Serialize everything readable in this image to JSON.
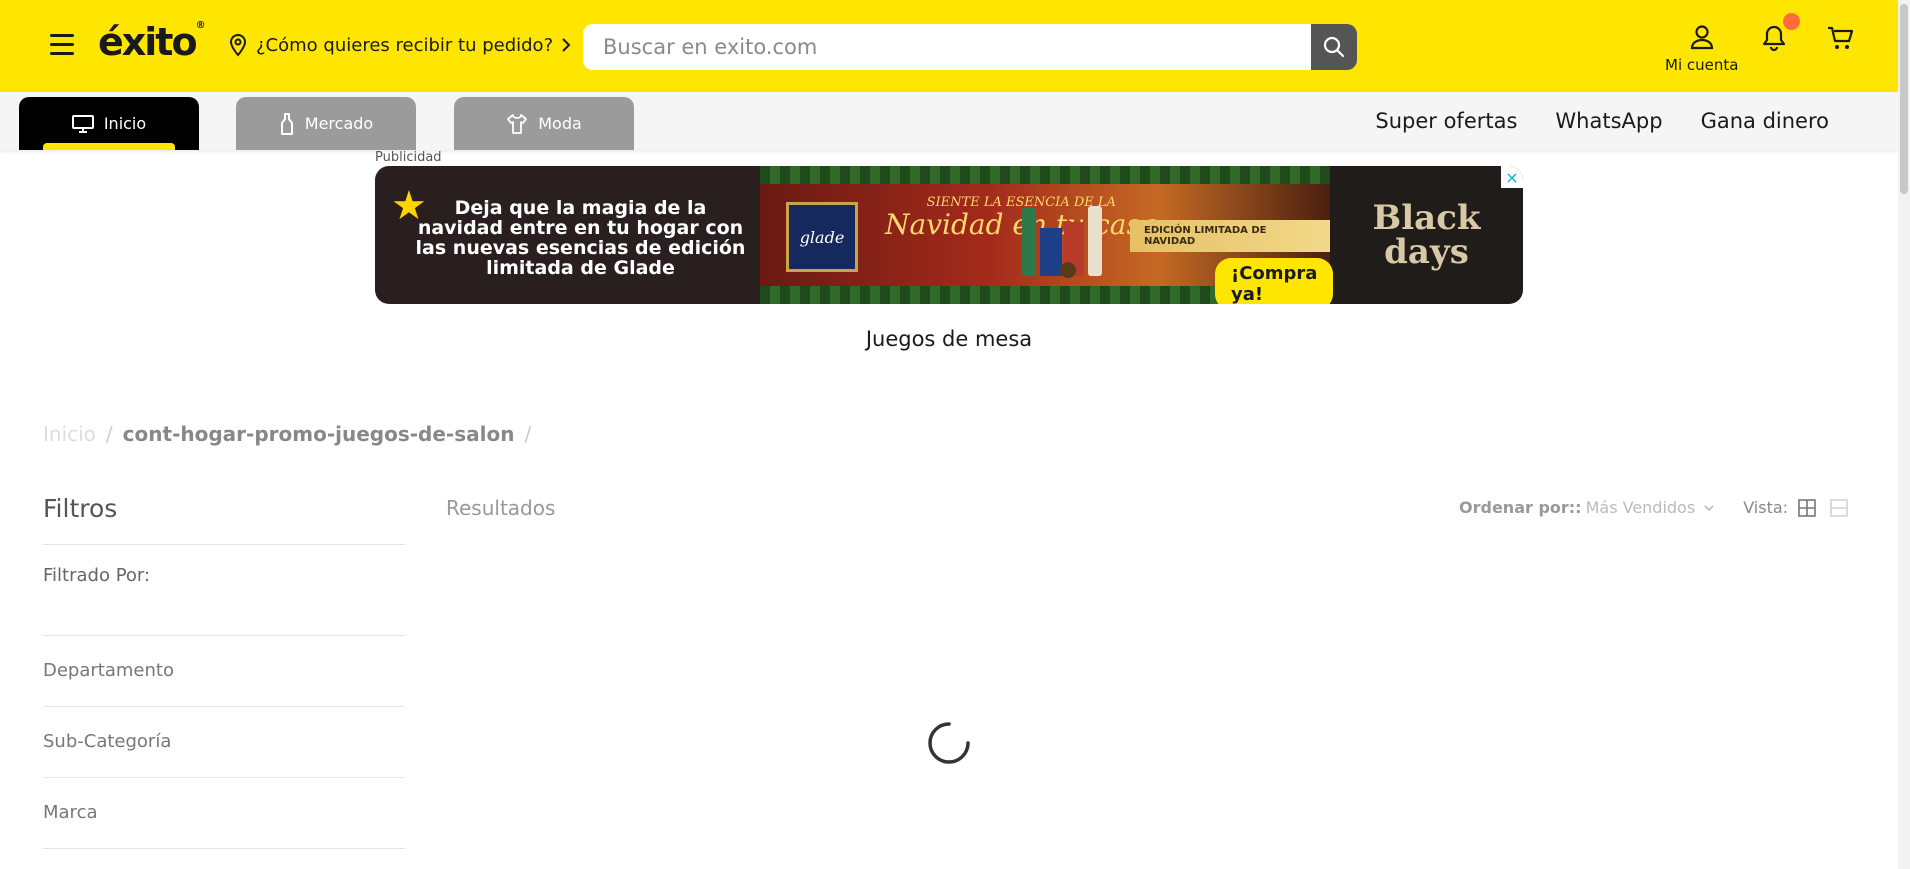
{
  "header": {
    "logo_text": "éxito",
    "logo_reg": "®",
    "location_prompt": "¿Cómo quieres recibir tu pedido?",
    "search_placeholder": "Buscar en exito.com",
    "account_label": "Mi cuenta",
    "accent_color": "#ffe600",
    "notification_dot_color": "#ff6b3d"
  },
  "nav": {
    "tabs": [
      {
        "label": "Inicio",
        "icon": "monitor-icon",
        "active": true
      },
      {
        "label": "Mercado",
        "icon": "bottle-icon",
        "active": false
      },
      {
        "label": "Moda",
        "icon": "shirt-icon",
        "active": false
      }
    ],
    "links": [
      "Super ofertas",
      "WhatsApp",
      "Gana dinero"
    ]
  },
  "ad": {
    "label": "Publicidad",
    "left_text": "Deja que la magia de la navidad entre en tu hogar con las nuevas esencias de edición limitada de Glade",
    "brand": "glade",
    "tagline_top": "SIENTE LA ESENCIA DE LA",
    "tagline_big": "Navidad en tu casa",
    "ribbon": "EDICIÓN LIMITADA DE NAVIDAD",
    "cta": "¡Compra ya!",
    "right_text": "Black days"
  },
  "page": {
    "title": "Juegos de mesa"
  },
  "breadcrumb": {
    "home": "Inicio",
    "separator": "/",
    "current": "cont-hogar-promo-juegos-de-salon"
  },
  "filters": {
    "title": "Filtros",
    "filtered_by": "Filtrado Por:",
    "items": [
      "Departamento",
      "Sub-Categoría",
      "Marca"
    ]
  },
  "results": {
    "label": "Resultados",
    "sort_label": "Ordenar por::",
    "sort_value": "Más Vendidos",
    "view_label": "Vista:"
  }
}
